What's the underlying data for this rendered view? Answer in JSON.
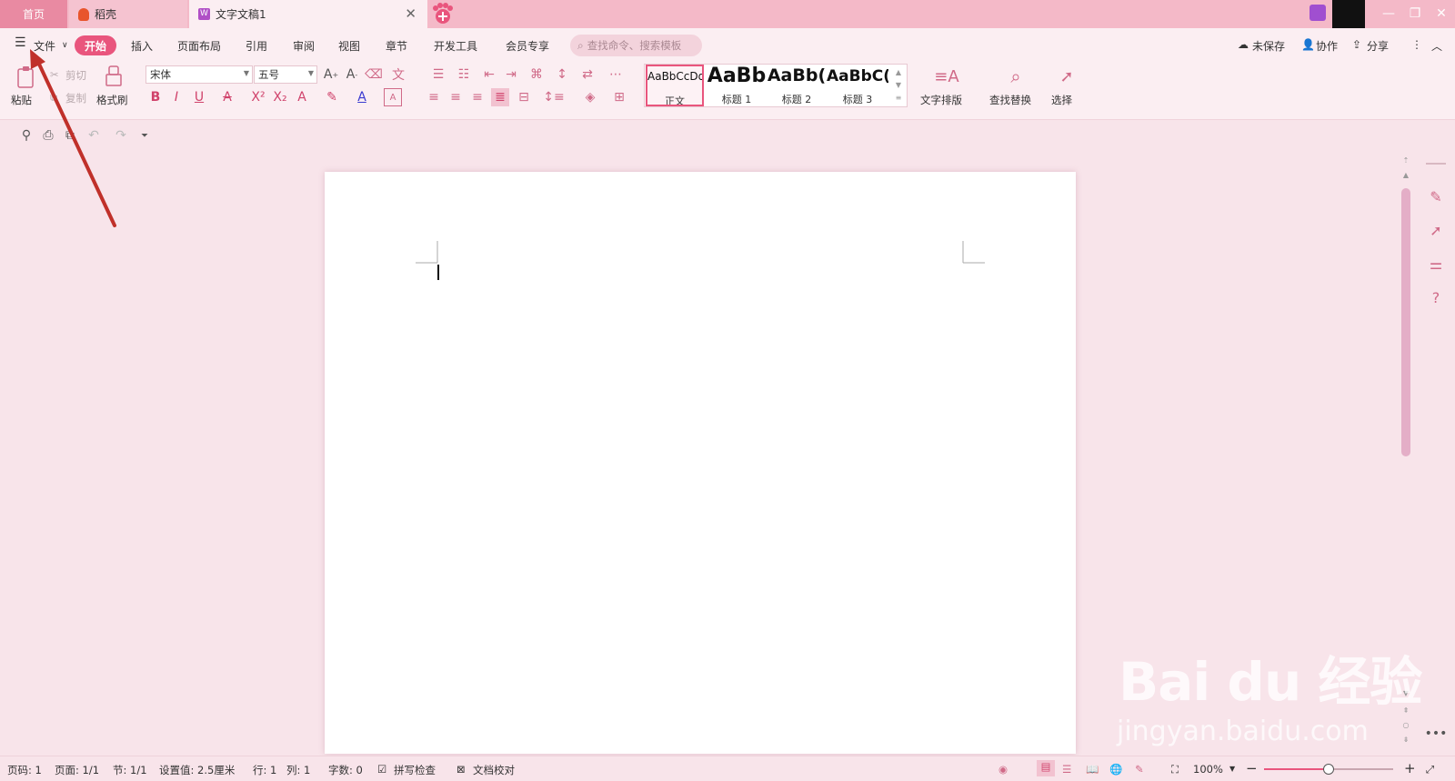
{
  "titlebar": {
    "tabs": [
      {
        "label": "首页"
      },
      {
        "label": "稻壳"
      },
      {
        "label": "文字文稿1"
      }
    ]
  },
  "menubar": {
    "file_label": "文件",
    "items": [
      "开始",
      "插入",
      "页面布局",
      "引用",
      "审阅",
      "视图",
      "章节",
      "开发工具",
      "会员专享"
    ],
    "search_placeholder": "查找命令、搜索模板",
    "right": {
      "unsaved": "未保存",
      "collab": "协作",
      "share": "分享"
    }
  },
  "ribbon": {
    "paste": "粘贴",
    "cut": "剪切",
    "copy": "复制",
    "format_painter": "格式刷",
    "font_name": "宋体",
    "font_size": "五号",
    "styles": [
      {
        "sample": "AaBbCcDd",
        "name": "正文"
      },
      {
        "sample": "AaBb",
        "name": "标题 1"
      },
      {
        "sample": "AaBb(",
        "name": "标题 2"
      },
      {
        "sample": "AaBbC(",
        "name": "标题 3"
      }
    ],
    "text_layout": "文字排版",
    "find_replace": "查找替换",
    "select": "选择"
  },
  "statusbar": {
    "page_no": "页码: 1",
    "pages": "页面: 1/1",
    "section": "节: 1/1",
    "setting": "设置值: 2.5厘米",
    "row": "行: 1",
    "col": "列: 1",
    "words": "字数: 0",
    "spell": "拼写检查",
    "proof": "文档校对",
    "zoom": "100%"
  },
  "watermark": {
    "logo": "Bai du 经验",
    "url": "jingyan.baidu.com"
  },
  "colors": {
    "accent": "#e9557d",
    "tabbar": "#f4b9c8",
    "annotation_arrow": "#c0302a"
  }
}
